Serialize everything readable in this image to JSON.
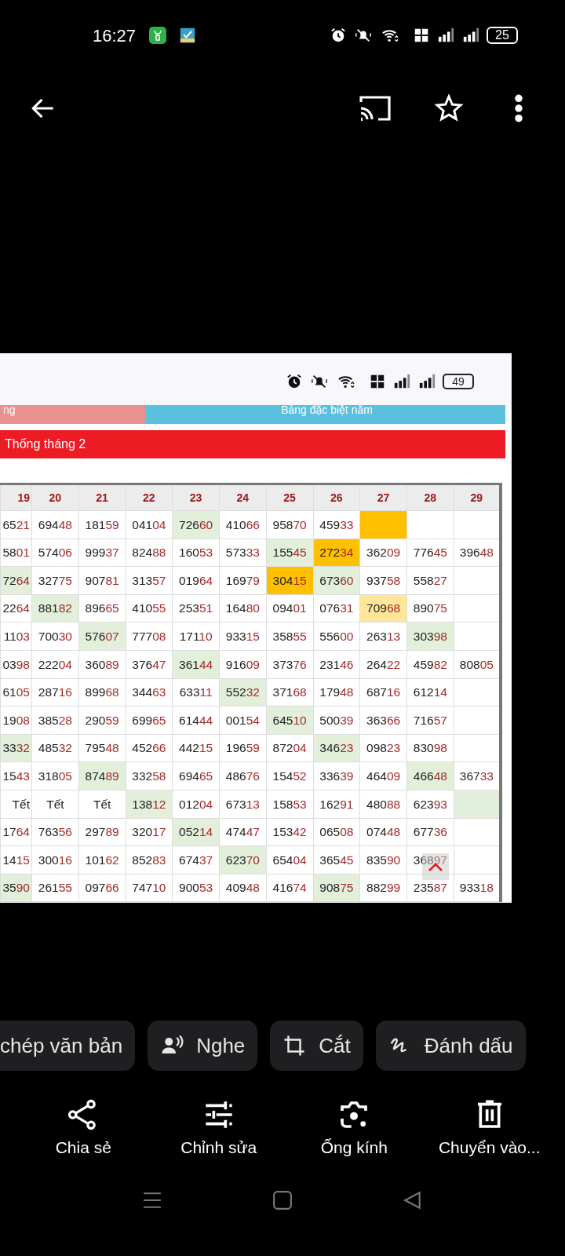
{
  "status_bar": {
    "time": "16:27",
    "battery": "25"
  },
  "screenshot": {
    "status_bar": {
      "battery": "49"
    },
    "tabs": [
      {
        "label": "ng",
        "color": "#e79191"
      },
      {
        "label": "Bảng đặc biệt năm",
        "color": "#5bc0de"
      }
    ],
    "title": "Thống tháng 2",
    "table": {
      "columns": [
        "19",
        "20",
        "21",
        "22",
        "23",
        "24",
        "25",
        "26",
        "27",
        "28",
        "29"
      ],
      "rows": [
        [
          {
            "text": "6521"
          },
          {
            "text": "69448"
          },
          {
            "text": "18159"
          },
          {
            "text": "04104"
          },
          {
            "text": "72660",
            "color": "#e2efda"
          },
          {
            "text": "41066"
          },
          {
            "text": "95870"
          },
          {
            "text": "45933"
          },
          {
            "kind": "empty",
            "color": "#ffc000"
          },
          {
            "kind": "empty"
          },
          {
            "kind": "empty"
          }
        ],
        [
          {
            "text": "5801"
          },
          {
            "text": "57406"
          },
          {
            "text": "99937"
          },
          {
            "text": "82488"
          },
          {
            "text": "16053"
          },
          {
            "text": "57333"
          },
          {
            "text": "15545",
            "color": "#e2efda"
          },
          {
            "text": "27234",
            "color": "#ffc000"
          },
          {
            "text": "36209"
          },
          {
            "text": "77645"
          },
          {
            "text": "39648"
          }
        ],
        [
          {
            "text": "7264",
            "color": "#e2efda"
          },
          {
            "text": "32775"
          },
          {
            "text": "90781"
          },
          {
            "text": "31357"
          },
          {
            "text": "01964"
          },
          {
            "text": "16979"
          },
          {
            "text": "30415",
            "color": "#ffc000"
          },
          {
            "text": "67360",
            "color": "#e2efda"
          },
          {
            "text": "93758"
          },
          {
            "text": "55827"
          },
          {
            "kind": "empty"
          }
        ],
        [
          {
            "text": "2264"
          },
          {
            "text": "88182",
            "color": "#e2efda"
          },
          {
            "text": "89665"
          },
          {
            "text": "41055"
          },
          {
            "text": "25351"
          },
          {
            "text": "16480"
          },
          {
            "text": "09401"
          },
          {
            "text": "07631"
          },
          {
            "text": "70968",
            "color": "#ffe699"
          },
          {
            "text": "89075"
          },
          {
            "kind": "empty"
          }
        ],
        [
          {
            "text": "1103"
          },
          {
            "text": "70030"
          },
          {
            "text": "57607",
            "color": "#e2efda"
          },
          {
            "text": "77708"
          },
          {
            "text": "17110"
          },
          {
            "text": "93315"
          },
          {
            "text": "35855"
          },
          {
            "text": "55600"
          },
          {
            "text": "26313"
          },
          {
            "text": "30398",
            "color": "#e2efda"
          },
          {
            "kind": "empty"
          }
        ],
        [
          {
            "text": "0398"
          },
          {
            "text": "22204"
          },
          {
            "text": "36089"
          },
          {
            "text": "37647"
          },
          {
            "text": "36144",
            "color": "#e2efda"
          },
          {
            "text": "91609"
          },
          {
            "text": "37376"
          },
          {
            "text": "23146"
          },
          {
            "text": "26422"
          },
          {
            "text": "45982"
          },
          {
            "text": "80805"
          }
        ],
        [
          {
            "text": "6105"
          },
          {
            "text": "28716"
          },
          {
            "text": "89968"
          },
          {
            "text": "34463"
          },
          {
            "text": "63311"
          },
          {
            "text": "55232",
            "color": "#e2efda"
          },
          {
            "text": "37168"
          },
          {
            "text": "17948"
          },
          {
            "text": "68716"
          },
          {
            "text": "61214"
          },
          {
            "kind": "empty"
          }
        ],
        [
          {
            "text": "1908"
          },
          {
            "text": "38528"
          },
          {
            "text": "29059"
          },
          {
            "text": "69965"
          },
          {
            "text": "61444"
          },
          {
            "text": "00154"
          },
          {
            "text": "64510",
            "color": "#e2efda"
          },
          {
            "text": "50039"
          },
          {
            "text": "36366"
          },
          {
            "text": "71657"
          },
          {
            "kind": "empty"
          }
        ],
        [
          {
            "text": "3332",
            "color": "#e2efda"
          },
          {
            "text": "48532"
          },
          {
            "text": "79548"
          },
          {
            "text": "45266"
          },
          {
            "text": "44215"
          },
          {
            "text": "19659"
          },
          {
            "text": "87204"
          },
          {
            "text": "34623",
            "color": "#e2efda"
          },
          {
            "text": "09823"
          },
          {
            "text": "83098"
          },
          {
            "kind": "empty"
          }
        ],
        [
          {
            "text": "1543"
          },
          {
            "text": "31805"
          },
          {
            "text": "87489",
            "color": "#e2efda"
          },
          {
            "text": "33258"
          },
          {
            "text": "69465"
          },
          {
            "text": "48676"
          },
          {
            "text": "15452"
          },
          {
            "text": "33639"
          },
          {
            "text": "46409"
          },
          {
            "text": "46648",
            "color": "#e2efda"
          },
          {
            "text": "36733"
          }
        ],
        [
          {
            "text": "Tết",
            "kind": "text"
          },
          {
            "text": "Tết",
            "kind": "text"
          },
          {
            "text": "Tết",
            "kind": "text"
          },
          {
            "text": "13812",
            "color": "#e2efda"
          },
          {
            "text": "01204"
          },
          {
            "text": "67313"
          },
          {
            "text": "15853"
          },
          {
            "text": "16291"
          },
          {
            "text": "48088"
          },
          {
            "text": "62393"
          },
          {
            "kind": "empty",
            "color": "#e2efda"
          }
        ],
        [
          {
            "text": "1764"
          },
          {
            "text": "76356"
          },
          {
            "text": "29789"
          },
          {
            "text": "32017"
          },
          {
            "text": "05214",
            "color": "#e2efda"
          },
          {
            "text": "47447"
          },
          {
            "text": "15342"
          },
          {
            "text": "06508"
          },
          {
            "text": "07448"
          },
          {
            "text": "67736"
          },
          {
            "kind": "empty"
          }
        ],
        [
          {
            "text": "1415"
          },
          {
            "text": "30016"
          },
          {
            "text": "10162"
          },
          {
            "text": "85283"
          },
          {
            "text": "67437"
          },
          {
            "text": "62370",
            "color": "#e2efda"
          },
          {
            "text": "65404"
          },
          {
            "text": "36545"
          },
          {
            "text": "83590"
          },
          {
            "text": "36897",
            "overlay": true
          },
          {
            "kind": "empty"
          }
        ],
        [
          {
            "text": "3590",
            "color": "#e2efda"
          },
          {
            "text": "26155"
          },
          {
            "text": "09766"
          },
          {
            "text": "74710"
          },
          {
            "text": "90053"
          },
          {
            "text": "40948"
          },
          {
            "text": "41674"
          },
          {
            "text": "90875",
            "color": "#e2efda"
          },
          {
            "text": "88299"
          },
          {
            "text": "23587"
          },
          {
            "text": "93318"
          }
        ]
      ]
    }
  },
  "chips": [
    {
      "label": "chép văn bản"
    },
    {
      "label": "Nghe"
    },
    {
      "label": "Cắt"
    },
    {
      "label": "Đánh dấu"
    }
  ],
  "actions": [
    {
      "label": "Chia sẻ"
    },
    {
      "label": "Chỉnh sửa"
    },
    {
      "label": "Ống kính"
    },
    {
      "label": "Chuyển vào..."
    }
  ]
}
